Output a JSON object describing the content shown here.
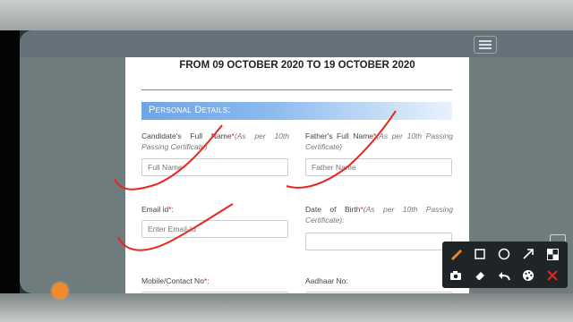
{
  "form": {
    "heading": "FROM 09 OCTOBER 2020 TO 19 OCTOBER 2020",
    "section_title": "Personal Details:",
    "fields": {
      "candidate_name": {
        "label": "Candidate's Full Name",
        "required": "*",
        "hint": "(As per 10th Passing Certificate)",
        "placeholder": "Full Name"
      },
      "father_name": {
        "label": "Father's Full Name",
        "required": "*",
        "hint": "(As per 10th Passing Certificate)",
        "placeholder": "Father Name"
      },
      "email": {
        "label": "Email id",
        "required": "*",
        "hint": ":",
        "placeholder": "Enter Email-Id"
      },
      "dob": {
        "label": "Date of Birth",
        "required": "*",
        "hint": "(As per 10th Passing Certificate):",
        "placeholder": ""
      },
      "mobile": {
        "label": "Mobile/Contact No",
        "required": "*",
        "hint": ":"
      },
      "aadhaar": {
        "label": "Aadhaar No:"
      }
    }
  },
  "toolbar": {
    "tools": [
      "pen-icon",
      "rectangle-icon",
      "circle-icon",
      "arrow-icon",
      "blur-icon",
      "camera-icon",
      "eraser-icon",
      "undo-icon",
      "palette-icon",
      "close-icon"
    ]
  },
  "colors": {
    "section_gradient_start": "#6fa5e6",
    "required": "#e0211b",
    "annotation_ink": "#e8261c"
  }
}
